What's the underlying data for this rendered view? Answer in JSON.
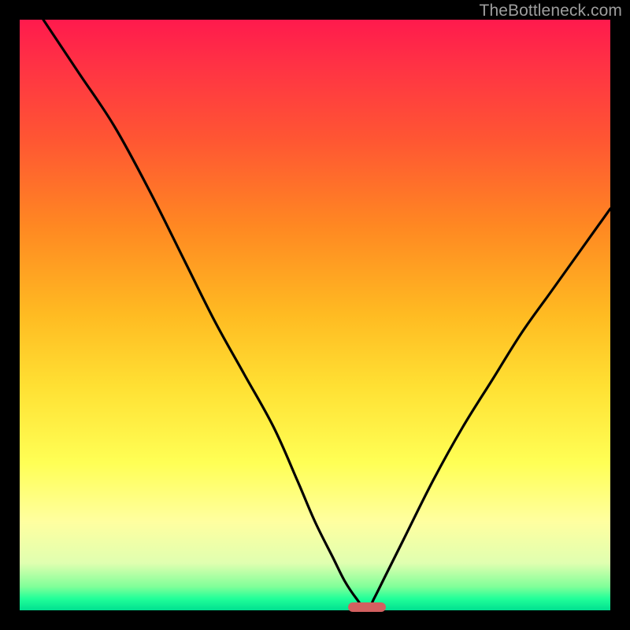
{
  "watermark": {
    "text": "TheBottleneck.com"
  },
  "chart_data": {
    "type": "line",
    "title": "",
    "xlabel": "",
    "ylabel": "",
    "xlim": [
      0,
      100
    ],
    "ylim": [
      0,
      100
    ],
    "grid": false,
    "legend": false,
    "series": [
      {
        "name": "bottleneck-curve",
        "x": [
          4,
          10,
          16,
          22,
          28,
          33,
          38,
          43,
          47,
          50,
          53,
          55,
          57,
          58.8,
          60,
          62,
          65,
          70,
          75,
          80,
          85,
          90,
          95,
          100
        ],
        "y": [
          100,
          91,
          82,
          71,
          59,
          49,
          40,
          31,
          22,
          15,
          9,
          5,
          2,
          0,
          2,
          6,
          12,
          22,
          31,
          39,
          47,
          54,
          61,
          68
        ]
      }
    ],
    "marker": {
      "x_center": 58.8,
      "width_pct": 6.5,
      "color": "#d36060"
    },
    "background_gradient": {
      "top": "#ff1a4d",
      "mid": "#ffff55",
      "bottom": "#00e090"
    }
  }
}
